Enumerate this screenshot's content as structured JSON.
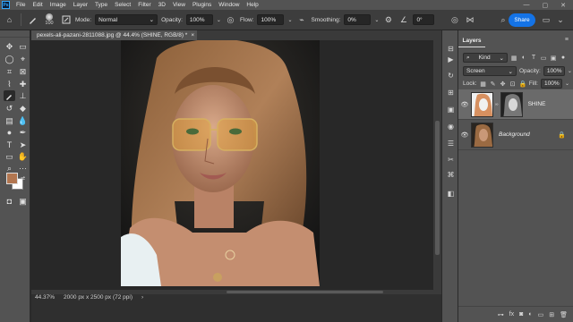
{
  "menu": {
    "logo": "Ps",
    "items": [
      "File",
      "Edit",
      "Image",
      "Layer",
      "Type",
      "Select",
      "Filter",
      "3D",
      "View",
      "Plugins",
      "Window",
      "Help"
    ],
    "window_controls": [
      "—",
      "▢",
      "✕"
    ]
  },
  "options": {
    "brush_size": "100",
    "mode_label": "Mode:",
    "mode_value": "Normal",
    "opacity_label": "Opacity:",
    "opacity_value": "100%",
    "flow_label": "Flow:",
    "flow_value": "100%",
    "smoothing_label": "Smoothing:",
    "smoothing_value": "0%",
    "angle_value": "0°",
    "share_label": "Share"
  },
  "document": {
    "tab_title": "pexels-ali-pazani-2811088.jpg @ 44.4% (SHINE, RGB/8) *",
    "tab_close": "×",
    "zoom": "44.37%",
    "doc_info": "2000 px x 2500 px (72 ppi)",
    "status_arrow": "›"
  },
  "colors": {
    "foreground": "#b27650",
    "background": "#ffffff",
    "accent": "#1473e6"
  },
  "layers_panel": {
    "tab_label": "Layers",
    "filter_value": "Kind",
    "blend_mode": "Screen",
    "opacity_label": "Opacity:",
    "opacity_value": "100%",
    "lock_label": "Lock:",
    "fill_label": "Fill:",
    "fill_value": "100%",
    "layers": [
      {
        "name": "SHINE",
        "visible": true,
        "selected": true
      },
      {
        "name": "Background",
        "visible": true,
        "selected": false,
        "locked": true
      }
    ],
    "bottom_icons": [
      "link-icon",
      "fx-icon",
      "mask-icon",
      "adjustment-icon",
      "group-icon",
      "new-layer-icon",
      "trash-icon"
    ],
    "fx_label": "fx"
  }
}
